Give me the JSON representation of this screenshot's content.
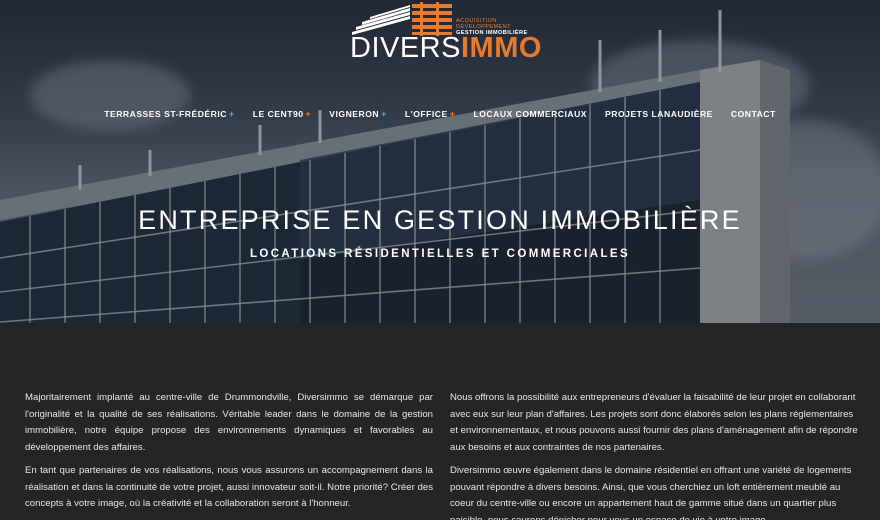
{
  "logo": {
    "tagline": [
      "ACQUISITION",
      "DÉVELOPPEMENT",
      "GESTION IMMOBILIÈRE"
    ],
    "word_part1": "DIVERS",
    "word_part2": "IMMO"
  },
  "nav": {
    "items": [
      {
        "label": "TERRASSES ST-FRÉDÉRIC",
        "plus": "+",
        "plus_color": "blue"
      },
      {
        "label": "LE CENT90",
        "plus": "+",
        "plus_color": "orange"
      },
      {
        "label": "VIGNERON",
        "plus": "+",
        "plus_color": "blue"
      },
      {
        "label": "L'OFFICE",
        "plus": "+",
        "plus_color": "orange"
      },
      {
        "label": "LOCAUX COMMERCIAUX",
        "plus": "",
        "plus_color": ""
      },
      {
        "label": "PROJETS LANAUDIÈRE",
        "plus": "",
        "plus_color": ""
      },
      {
        "label": "CONTACT",
        "plus": "",
        "plus_color": ""
      }
    ]
  },
  "hero": {
    "title": "ENTREPRISE EN GESTION IMMOBILIÈRE",
    "subtitle": "LOCATIONS RÉSIDENTIELLES ET COMMERCIALES"
  },
  "content": {
    "left": [
      "Majoritairement implanté au centre-ville de Drummondville, Diversimmo se démarque par l'originalité et la qualité de ses réalisations. Véritable leader dans le domaine de la gestion immobilière, notre équipe propose des environnements dynamiques et favorables au développement des affaires.",
      "En tant que partenaires de vos réalisations, nous vous assurons un accompagnement dans la réalisation et dans la continuité de votre projet, aussi innovateur soit-il. Notre priorité? Créer des concepts à votre image, où la créativité et la collaboration seront à l'honneur."
    ],
    "right": [
      "Nous offrons la possibilité aux entrepreneurs d'évaluer la faisabilité de leur projet en collaborant avec eux sur leur plan d'affaires. Les projets sont donc élaborés selon les plans réglementaires et environnementaux, et nous pouvons aussi fournir des plans d'aménagement afin de répondre aux besoins et aux contraintes de nos partenaires.",
      "Diversimmo œuvre également dans le domaine résidentiel en offrant une variété de logements pouvant répondre à divers besoins. Ainsi, que vous cherchiez un loft entièrement meublé au coeur du centre-ville ou encore un appartement haut de gamme situé dans un quartier plus paisible, nous saurons dénicher pour vous un espace de vie à votre image."
    ]
  },
  "colors": {
    "accent_orange": "#e87a2f",
    "accent_blue": "#5aa4d8",
    "content_bg": "#252525"
  }
}
